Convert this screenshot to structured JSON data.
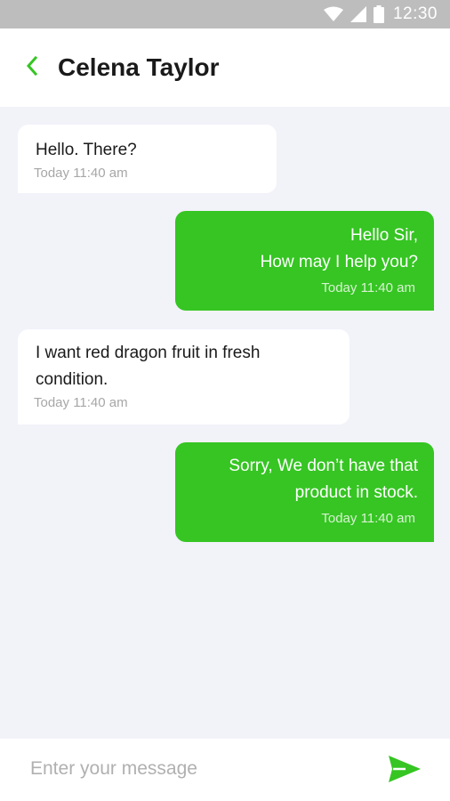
{
  "status_bar": {
    "time": "12:30",
    "icons": [
      "wifi-icon",
      "signal-icon",
      "battery-icon"
    ]
  },
  "header": {
    "back_icon": "chevron-left-icon",
    "title": "Celena Taylor"
  },
  "messages": [
    {
      "direction": "in",
      "text": "Hello. There?",
      "time": "Today  11:40 am"
    },
    {
      "direction": "out",
      "text": "Hello Sir,\nHow may I help you?",
      "time": "Today  11:40 am"
    },
    {
      "direction": "in",
      "text": "I want red dragon fruit in fresh\ncondition.",
      "time": "Today  11:40 am"
    },
    {
      "direction": "out",
      "text": "Sorry, We don’t have that\nproduct in stock.",
      "time": "Today  11:40 am"
    }
  ],
  "composer": {
    "placeholder": "Enter your message",
    "value": "",
    "send_icon": "send-icon"
  },
  "colors": {
    "accent": "#36c523",
    "background": "#f2f2f9",
    "status_bar": "#bdbdbd"
  }
}
